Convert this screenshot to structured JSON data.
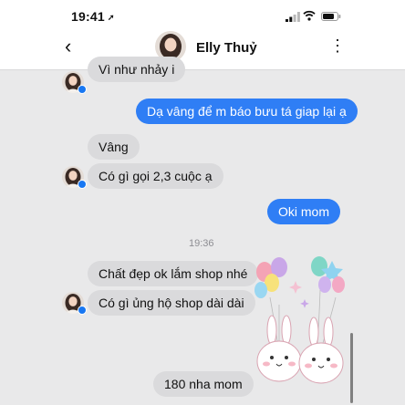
{
  "status_bar": {
    "time": "19:41",
    "location_glyph": "➚",
    "icons": [
      "cellular-signal-icon",
      "wifi-icon",
      "battery-icon"
    ]
  },
  "header": {
    "back_glyph": "‹",
    "contact_name": "Elly Thuỷ",
    "menu_glyph": "⋮"
  },
  "messages": [
    {
      "side": "in",
      "text": "Vì như nhảy i",
      "partial": true
    },
    {
      "side": "out",
      "text": "Dạ vâng để m báo bưu tá giap lại ạ"
    },
    {
      "side": "in",
      "text": "Vâng"
    },
    {
      "side": "in",
      "text": "Có gì gọi 2,3 cuộc ạ"
    },
    {
      "side": "out",
      "text": "Oki mom"
    },
    {
      "side": "in",
      "text": "Chất đẹp ok lắm shop nhé"
    },
    {
      "side": "in",
      "text": "Có gì ủng hộ shop dài dài"
    },
    {
      "side": "in",
      "text": "180 nha mom"
    }
  ],
  "timestamp": "19:36",
  "sticker": {
    "name": "bunny-balloons-sticker"
  },
  "colors": {
    "outgoing_bubble": "#2f7ef5",
    "incoming_bubble": "#dadadc",
    "chat_background": "#e9e9ea",
    "verified_badge": "#1877f2"
  }
}
